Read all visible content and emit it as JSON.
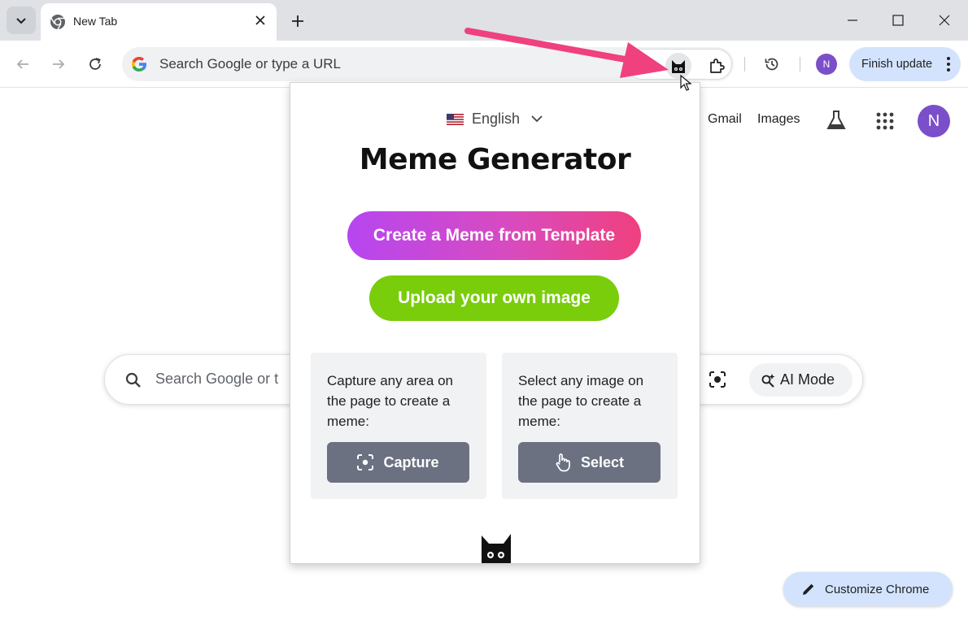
{
  "browser": {
    "tab_title": "New Tab",
    "omnibox_placeholder": "Search Google or type a URL",
    "finish_update_label": "Finish update",
    "profile_initial": "N",
    "icons": [
      "tab-search-icon",
      "chrome-favicon-icon",
      "tab-close-icon",
      "new-tab-icon",
      "minimize-icon",
      "maximize-icon",
      "window-close-icon",
      "back-icon",
      "forward-icon",
      "reload-icon",
      "google-g-icon",
      "meme-cat-extension-icon",
      "extensions-puzzle-icon",
      "history-icon",
      "more-vert-icon"
    ]
  },
  "google_page": {
    "links": [
      "Gmail",
      "Images"
    ],
    "profile_initial": "N",
    "search_placeholder": "Search Google or t",
    "ai_mode_label": "AI Mode",
    "customize_label": "Customize Chrome",
    "icons": [
      "labs-flask-icon",
      "apps-grid-icon",
      "search-magnifier-icon",
      "google-lens-icon",
      "ai-mode-sparkle-icon",
      "pencil-icon"
    ]
  },
  "popup": {
    "language": "English",
    "title": "Meme Generator",
    "primary_button": "Create a Meme from Template",
    "secondary_button": "Upload your own image",
    "cards": [
      {
        "description": "Capture any area on the page to create a meme:",
        "button": "Capture",
        "icon": "capture-frame-icon"
      },
      {
        "description": "Select any image on the page to create a meme:",
        "button": "Select",
        "icon": "hand-pointer-icon"
      }
    ]
  },
  "colors": {
    "accent_blue": "#d3e3fd",
    "avatar_purple": "#7b4fc9",
    "template_gradient": [
      "#b646f0",
      "#f0407e"
    ],
    "upload_green": "#79cd0b",
    "card_button_gray": "#6b7180",
    "annotation_arrow": "#f0407e"
  }
}
